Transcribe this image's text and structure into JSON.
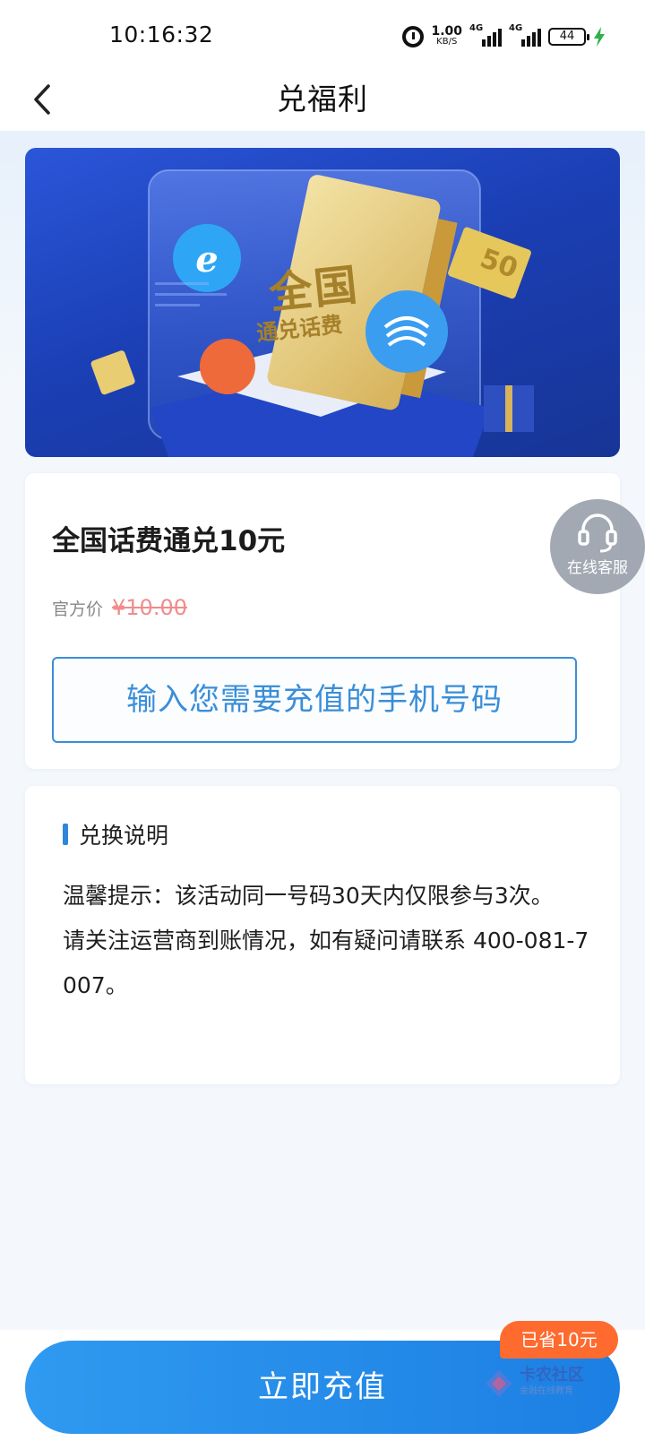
{
  "status_bar": {
    "time": "10:16:32",
    "net_speed": "1.00",
    "net_unit": "KB/S",
    "signal_tag": "4G",
    "battery": "44"
  },
  "nav": {
    "title": "兑福利",
    "back_icon": "chevron-left-icon"
  },
  "banner": {
    "headline_line1": "全国",
    "headline_line2": "通兑话费",
    "coin_value": "50"
  },
  "product": {
    "title": "全国话费通兑10元",
    "price_label": "官方价",
    "original_price": "¥10.00",
    "phone_placeholder": "输入您需要充值的手机号码"
  },
  "customer_service": {
    "label": "在线客服",
    "icon": "headset-icon"
  },
  "instructions": {
    "title": "兑换说明",
    "text_line1": "温馨提示：该活动同一号码30天内仅限参与3次。",
    "text_line2": "请关注运营商到账情况，如有疑问请联系 400-081-7007。"
  },
  "bottom": {
    "button_label": "立即充值",
    "saved_badge": "已省10元"
  },
  "watermark": {
    "main": "卡农社区",
    "sub": "金融在线教育"
  },
  "colors": {
    "accent": "#2f86db",
    "button": "#1c7fe3",
    "badge": "#ff6a2f",
    "price_strike": "#f08c8c"
  }
}
